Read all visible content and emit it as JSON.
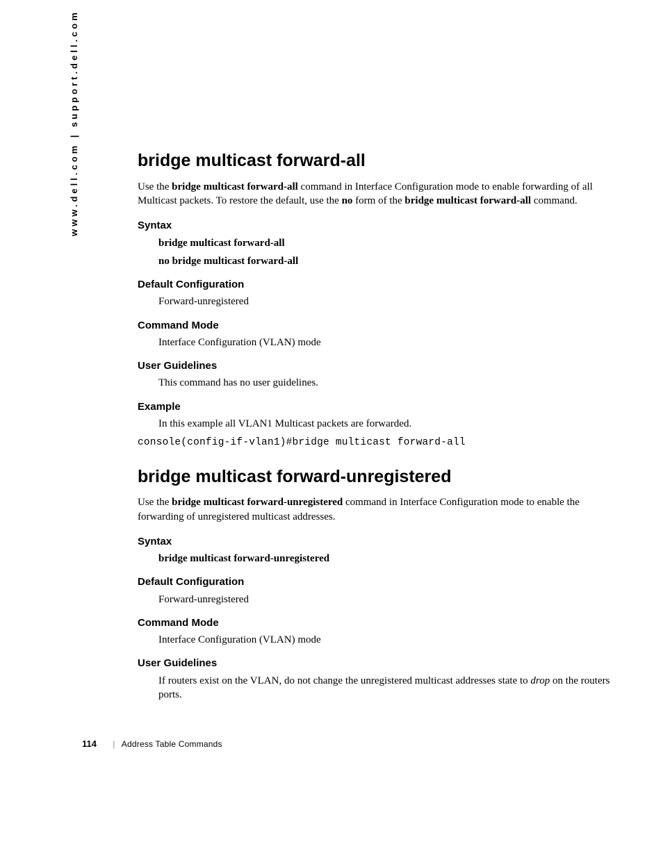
{
  "sidebar": {
    "url_text": "www.dell.com | support.dell.com"
  },
  "section1": {
    "title": "bridge multicast forward-all",
    "desc_pre": "Use the ",
    "desc_cmd": "bridge multicast forward-all",
    "desc_mid": " command in Interface Configuration mode to enable forwarding of all Multicast packets. To restore the default, use the ",
    "desc_no": "no",
    "desc_mid2": " form of the ",
    "desc_cmd2": "bridge multicast forward-all",
    "desc_end": " command.",
    "syntax_head": "Syntax",
    "syntax_line1": "bridge multicast forward-all",
    "syntax_line2": "no bridge multicast forward-all",
    "default_head": "Default Configuration",
    "default_body": "Forward-unregistered",
    "mode_head": "Command Mode",
    "mode_body": "Interface Configuration (VLAN) mode",
    "guide_head": "User Guidelines",
    "guide_body": "This command has no user guidelines.",
    "example_head": "Example",
    "example_body": "In this example all VLAN1 Multicast packets are forwarded.",
    "example_code": "console(config-if-vlan1)#bridge multicast forward-all"
  },
  "section2": {
    "title": "bridge multicast forward-unregistered",
    "desc_pre": "Use the ",
    "desc_cmd": "bridge multicast forward-unregistered",
    "desc_end": " command in Interface Configuration mode to enable the forwarding of unregistered multicast addresses.",
    "syntax_head": "Syntax",
    "syntax_line1": "bridge multicast forward-unregistered",
    "default_head": "Default Configuration",
    "default_body": "Forward-unregistered",
    "mode_head": "Command Mode",
    "mode_body": "Interface Configuration (VLAN) mode",
    "guide_head": "User Guidelines",
    "guide_body_pre": "If routers exist on the VLAN, do not change the unregistered multicast addresses state to ",
    "guide_body_ital": "drop",
    "guide_body_post": " on the routers ports."
  },
  "footer": {
    "page": "114",
    "sep": "|",
    "chapter": "Address Table Commands"
  }
}
